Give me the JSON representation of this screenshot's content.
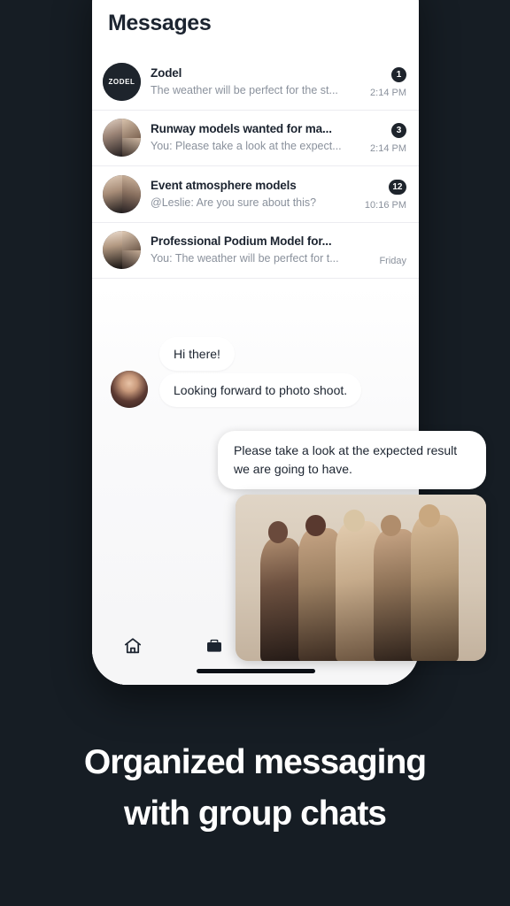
{
  "background_color": "#161d24",
  "screen": {
    "title": "Messages",
    "conversations": [
      {
        "name": "Zodel",
        "preview": "The weather will be perfect for the st...",
        "time": "2:14 PM",
        "badge": "1",
        "avatar_type": "zodel-logo",
        "avatar_label": "ZODEL"
      },
      {
        "name": "Runway models wanted for ma...",
        "preview": "You: Please take a look at the expect...",
        "time": "2:14 PM",
        "badge": "3",
        "avatar_type": "group-collage"
      },
      {
        "name": "Event atmosphere models",
        "preview": "@Leslie: Are you sure about this?",
        "time": "10:16 PM",
        "badge": "12",
        "avatar_type": "group-collage"
      },
      {
        "name": "Professional Podium Model for...",
        "preview": "You: The weather will be perfect for t...",
        "time": "Friday",
        "badge": "",
        "avatar_type": "group-collage"
      }
    ]
  },
  "chat": {
    "incoming": [
      {
        "text": "Hi there!"
      },
      {
        "text": "Looking forward to photo shoot."
      }
    ],
    "outgoing": {
      "text": "Please take a look at the expected result we are going to have."
    },
    "attachment": {
      "description": "Five models in metallic gold and black dresses posing together on a beige studio backdrop"
    }
  },
  "tab_bar": {
    "items": [
      {
        "icon": "home-icon",
        "active": false
      },
      {
        "icon": "briefcase-icon",
        "active": true
      }
    ]
  },
  "caption": {
    "line1": "Organized messaging",
    "line2": "with group chats"
  }
}
